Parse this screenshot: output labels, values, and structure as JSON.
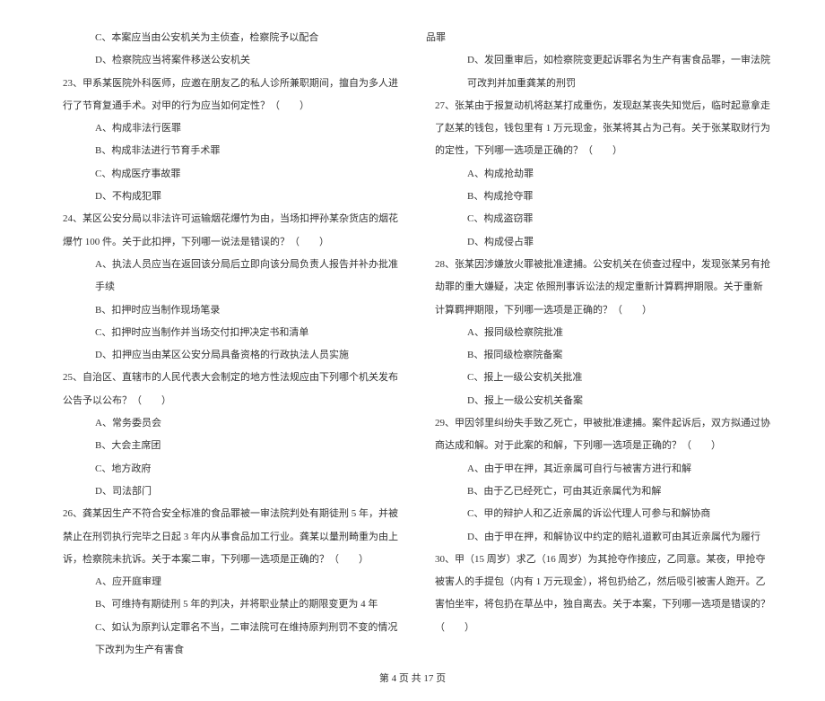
{
  "left_column": {
    "q22_options": [
      "C、本案应当由公安机关为主侦查，检察院予以配合",
      "D、检察院应当将案件移送公安机关"
    ],
    "q23": {
      "stem": "23、甲系某医院外科医师，应邀在朋友乙的私人诊所兼职期间，擅自为多人进行了节育复通手术。对甲的行为应当如何定性？（　　）",
      "options": [
        "A、构成非法行医罪",
        "B、构成非法进行节育手术罪",
        "C、构成医疗事故罪",
        "D、不构成犯罪"
      ]
    },
    "q24": {
      "stem": "24、某区公安分局以非法许可运输烟花爆竹为由，当场扣押孙某杂货店的烟花爆竹 100 件。关于此扣押，下列哪一说法是错误的？（　　）",
      "options": [
        "A、执法人员应当在返回该分局后立即向该分局负责人报告并补办批准手续",
        "B、扣押时应当制作现场笔录",
        "C、扣押时应当制作并当场交付扣押决定书和清单",
        "D、扣押应当由某区公安分局具备资格的行政执法人员实施"
      ]
    },
    "q25": {
      "stem": "25、自治区、直辖市的人民代表大会制定的地方性法规应由下列哪个机关发布公告予以公布？（　　）",
      "options": [
        "A、常务委员会",
        "B、大会主席团",
        "C、地方政府",
        "D、司法部门"
      ]
    },
    "q26": {
      "stem": "26、龚某因生产不符合安全标准的食品罪被一审法院判处有期徒刑 5 年，并被禁止在刑罚执行完毕之日起 3 年内从事食品加工行业。龚某以量刑畸重为由上诉，检察院未抗诉。关于本案二审，下列哪一选项是正确的？（　　）",
      "options": [
        "A、应开庭审理",
        "B、可维持有期徒刑 5 年的判决，并将职业禁止的期限变更为 4 年",
        "C、如认为原判认定罪名不当，二审法院可在维持原判刑罚不变的情况下改判为生产有害食"
      ]
    }
  },
  "right_column": {
    "q26_cont": "品罪",
    "q26_d": "D、发回重审后，如检察院变更起诉罪名为生产有害食品罪，一审法院可改判并加重龚某的刑罚",
    "q27": {
      "stem": "27、张某由于报复动机将赵某打成重伤，发现赵某丧失知觉后，临时起意拿走了赵某的钱包，钱包里有 1 万元现金，张某将其占为己有。关于张某取财行为的定性，下列哪一选项是正确的？（　　）",
      "options": [
        "A、构成抢劫罪",
        "B、构成抢夺罪",
        "C、构成盗窃罪",
        "D、构成侵占罪"
      ]
    },
    "q28": {
      "stem": "28、张某因涉嫌放火罪被批准逮捕。公安机关在侦查过程中，发现张某另有抢劫罪的重大嫌疑，决定 依照刑事诉讼法的规定重新计算羁押期限。关于重新计算羁押期限，下列哪一选项是正确的？（　　）",
      "options": [
        "A、报同级检察院批准",
        "B、报同级检察院备案",
        "C、报上一级公安机关批准",
        "D、报上一级公安机关备案"
      ]
    },
    "q29": {
      "stem": "29、甲因邻里纠纷失手致乙死亡，甲被批准逮捕。案件起诉后，双方拟通过协商达成和解。对于此案的和解，下列哪一选项是正确的？（　　）",
      "options": [
        "A、由于甲在押，其近亲属可自行与被害方进行和解",
        "B、由于乙已经死亡，可由其近亲属代为和解",
        "C、甲的辩护人和乙近亲属的诉讼代理人可参与和解协商",
        "D、由于甲在押，和解协议中约定的赔礼道歉可由其近亲属代为履行"
      ]
    },
    "q30": {
      "stem": "30、甲（15 周岁）求乙（16 周岁）为其抢夺作接应，乙同意。某夜，甲抢夺被害人的手提包（内有 1 万元现金），将包扔给乙，然后吸引被害人跑开。乙害怕坐牢，将包扔在草丛中，独自离去。关于本案，下列哪一选项是错误的？（　　）"
    }
  },
  "footer": "第 4 页 共 17 页"
}
